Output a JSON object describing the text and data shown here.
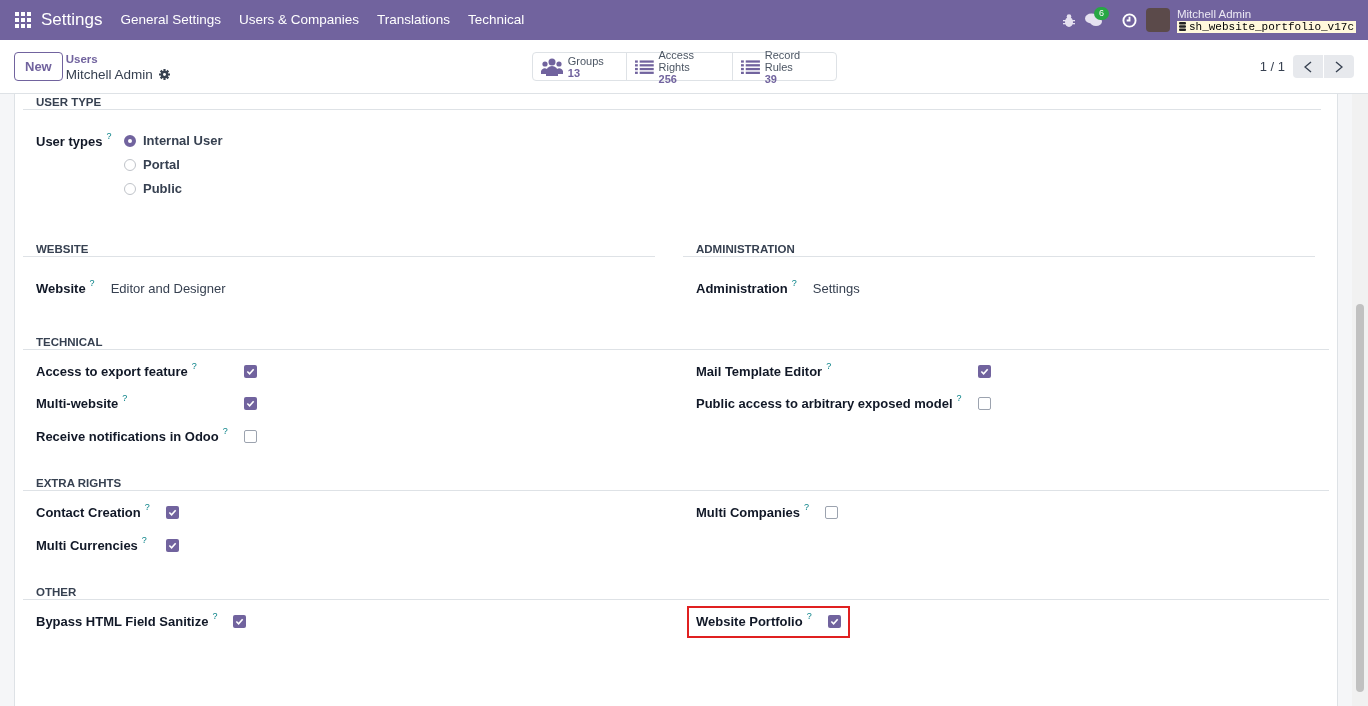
{
  "navbar": {
    "app": "Settings",
    "menus": [
      "General Settings",
      "Users & Companies",
      "Translations",
      "Technical"
    ],
    "chat_count": "6",
    "user": "Mitchell Admin",
    "database": "sh_website_portfolio_v17c"
  },
  "control_panel": {
    "new_button": "New",
    "breadcrumb": "Users",
    "record": "Mitchell Admin",
    "smart_buttons": [
      {
        "kind": "groups",
        "label": "Groups",
        "value": "13"
      },
      {
        "kind": "list",
        "label": "Access Rights",
        "value": "256"
      },
      {
        "kind": "list",
        "label": "Record Rules",
        "value": "39"
      }
    ],
    "pager": "1 / 1"
  },
  "sections": [
    {
      "kind": "radio",
      "title": "USER TYPE",
      "label": "User types",
      "help": "?",
      "options": [
        {
          "label": "Internal User",
          "selected": true
        },
        {
          "label": "Portal",
          "selected": false
        },
        {
          "label": "Public",
          "selected": false
        }
      ]
    },
    {
      "kind": "pair",
      "columns": [
        {
          "title": "WEBSITE",
          "label": "Website",
          "help": "?",
          "value": "Editor and Designer"
        },
        {
          "title": "ADMINISTRATION",
          "label": "Administration",
          "help": "?",
          "value": "Settings"
        }
      ]
    },
    {
      "kind": "checks",
      "title": "TECHNICAL",
      "columns": [
        [
          {
            "label": "Access to export feature",
            "help": "?",
            "checked": true,
            "highlighted": false
          },
          {
            "label": "Multi-website",
            "help": "?",
            "checked": true,
            "highlighted": false
          },
          {
            "label": "Receive notifications in Odoo",
            "help": "?",
            "checked": false,
            "highlighted": false
          }
        ],
        [
          {
            "label": "Mail Template Editor",
            "help": "?",
            "checked": true,
            "highlighted": false
          },
          {
            "label": "Public access to arbitrary exposed model",
            "help": "?",
            "checked": false,
            "highlighted": false
          }
        ]
      ]
    },
    {
      "kind": "checks",
      "title": "EXTRA RIGHTS",
      "columns": [
        [
          {
            "label": "Contact Creation",
            "help": "?",
            "checked": true,
            "highlighted": false
          },
          {
            "label": "Multi Currencies",
            "help": "?",
            "checked": true,
            "highlighted": false
          }
        ],
        [
          {
            "label": "Multi Companies",
            "help": "?",
            "checked": false,
            "highlighted": false
          }
        ]
      ]
    },
    {
      "kind": "checks",
      "title": "OTHER",
      "columns": [
        [
          {
            "label": "Bypass HTML Field Sanitize",
            "help": "?",
            "checked": true,
            "highlighted": false
          }
        ],
        [
          {
            "label": "Website Portfolio",
            "help": "?",
            "checked": true,
            "highlighted": true
          }
        ]
      ]
    }
  ]
}
